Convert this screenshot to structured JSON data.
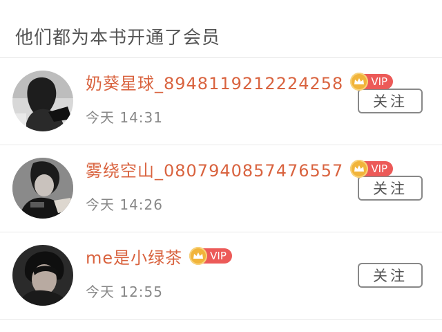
{
  "header": {
    "title": "他们都为本书开通了会员"
  },
  "members": [
    {
      "name": "奶葵星球_8948119212224258",
      "badge": "VIP",
      "time": "今天 14:31",
      "follow_label": "关注",
      "avatar": "avatar-image"
    },
    {
      "name": "雾绕空山_0807940857476557",
      "badge": "VIP",
      "time": "今天 14:26",
      "follow_label": "关注",
      "avatar": "avatar-image"
    },
    {
      "name": "me是小绿茶",
      "badge": "VIP",
      "time": "今天 12:55",
      "follow_label": "关注",
      "avatar": "avatar-image"
    }
  ],
  "colors": {
    "name": "#d9633f",
    "vip_badge": "#ec5a58",
    "crown": "#f1b43a",
    "divider": "#e8e8e8"
  }
}
